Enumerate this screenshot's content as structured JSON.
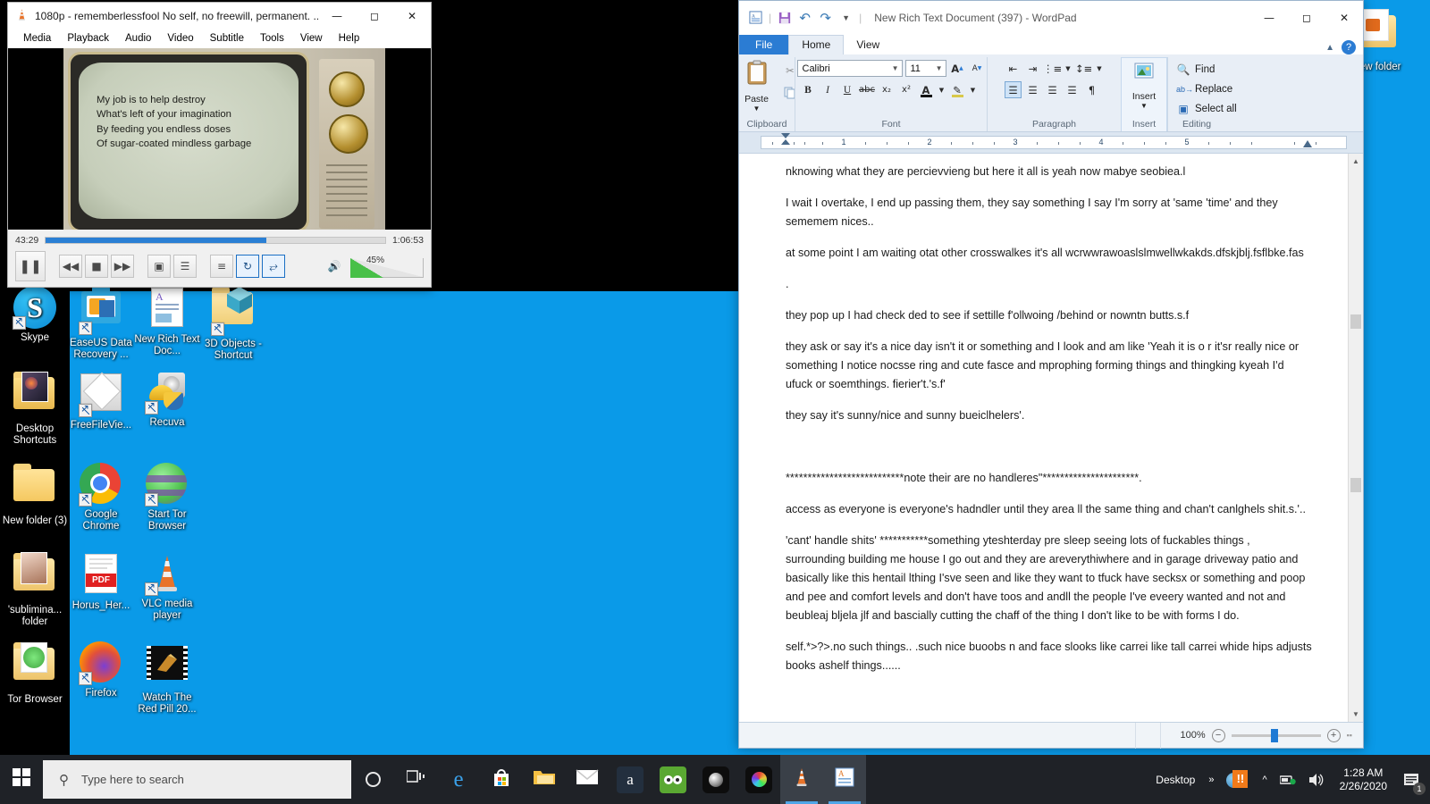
{
  "desktop": {
    "icons": [
      {
        "label": "Skype",
        "name": "desktop-icon-skype",
        "kind": "skype"
      },
      {
        "label": "EaseUS Data Recovery ...",
        "name": "desktop-icon-easeus",
        "kind": "easeus"
      },
      {
        "label": "New Rich Text Doc...",
        "name": "desktop-icon-new-rich-text-doc",
        "kind": "rtf"
      },
      {
        "label": "3D Objects - Shortcut",
        "name": "desktop-icon-3d-objects",
        "kind": "3dobjects"
      },
      {
        "label": "Desktop Shortcuts",
        "name": "desktop-icon-desktop-shortcuts",
        "kind": "folderpic"
      },
      {
        "label": "FreeFileVie...",
        "name": "desktop-icon-freefileviewer",
        "kind": "freefile"
      },
      {
        "label": "Recuva",
        "name": "desktop-icon-recuva",
        "kind": "recuva"
      },
      {
        "label": "New folder (3)",
        "name": "desktop-icon-new-folder-3",
        "kind": "folder"
      },
      {
        "label": "Google Chrome",
        "name": "desktop-icon-google-chrome",
        "kind": "chrome"
      },
      {
        "label": "Start Tor Browser",
        "name": "desktop-icon-start-tor-browser",
        "kind": "tor"
      },
      {
        "label": "'sublimina... folder",
        "name": "desktop-icon-subliminal-folder",
        "kind": "folderpic2"
      },
      {
        "label": "Horus_Her...",
        "name": "desktop-icon-horus-pdf",
        "kind": "pdf"
      },
      {
        "label": "VLC media player",
        "name": "desktop-icon-vlc-media-player",
        "kind": "vlc"
      },
      {
        "label": "Tor Browser",
        "name": "desktop-icon-tor-browser",
        "kind": "folderpic3"
      },
      {
        "label": "Firefox",
        "name": "desktop-icon-firefox",
        "kind": "firefox"
      },
      {
        "label": "Watch The Red Pill 20...",
        "name": "desktop-icon-watch-the-red-pill",
        "kind": "video"
      },
      {
        "label": "New folder",
        "name": "desktop-icon-new-folder-right",
        "kind": "folderpic4"
      }
    ]
  },
  "vlc": {
    "title": "1080p - rememberlessfool No self, no freewill, permanent. ...",
    "menu": [
      "Media",
      "Playback",
      "Audio",
      "Video",
      "Subtitle",
      "Tools",
      "View",
      "Help"
    ],
    "elapsed": "43:29",
    "total": "1:06:53",
    "progress_percent": 65,
    "volume_label": "45%",
    "volume_percent": 45,
    "buttons": {
      "play_pause": "pause-icon",
      "previous": "previous-track-icon",
      "stop": "stop-icon",
      "next": "next-track-icon",
      "fullscreen": "fullscreen-icon",
      "effects": "equalizer-icon",
      "playlist": "playlist-icon",
      "loop": "loop-icon",
      "shuffle": "shuffle-icon",
      "mute": "speaker-icon"
    },
    "video_caption": [
      "My job is to help destroy",
      "What's left of your imagination",
      "By feeding you endless doses",
      "Of sugar-coated mindless garbage"
    ]
  },
  "wordpad": {
    "title": "New Rich Text Document (397) - WordPad",
    "quick_access": [
      "wordpad-icon",
      "save-icon",
      "undo-icon",
      "redo-icon",
      "customize-qat-icon"
    ],
    "tabs": [
      {
        "label": "File",
        "name": "tab-file"
      },
      {
        "label": "Home",
        "name": "tab-home"
      },
      {
        "label": "View",
        "name": "tab-view"
      }
    ],
    "ribbon": {
      "clipboard": {
        "label": "Clipboard",
        "paste": "Paste",
        "cut": "cut-icon",
        "copy": "copy-icon"
      },
      "font": {
        "label": "Font",
        "family": "Calibri",
        "size": "11",
        "grow": "grow-font-icon",
        "shrink": "shrink-font-icon",
        "bold": "B",
        "italic": "I",
        "underline": "U",
        "strikethrough": "abc",
        "subscript": "x₂",
        "superscript": "x²",
        "text_color": "A",
        "highlight": "highlight-icon"
      },
      "paragraph": {
        "label": "Paragraph",
        "decrease_indent": "decrease-indent-icon",
        "increase_indent": "increase-indent-icon",
        "bullets": "bullets-icon",
        "line_spacing": "line-spacing-icon",
        "align_left": "align-left-icon",
        "align_center": "align-center-icon",
        "align_right": "align-right-icon",
        "justify": "justify-icon",
        "paragraph_settings": "paragraph-settings-icon"
      },
      "insert": {
        "label": "Insert",
        "button": "Insert"
      },
      "editing": {
        "label": "Editing",
        "find": "Find",
        "replace": "Replace",
        "select_all": "Select all"
      }
    },
    "ruler_numbers": [
      "1",
      "2",
      "3",
      "4",
      "5"
    ],
    "document": [
      "nknowing what they are percievvieng but here it all is yeah now mabye seobiea.l",
      "I wait I overtake, I end up passing them, they say something I say I'm sorry at 'same 'time' and they sememem nices..",
      "at some point I am waiting otat other crosswalkes it's all wcrwwrawoaslslmwellwkakds.dfskjblj.fsflbke.fas",
      ".",
      " they pop up I had check ded to see if settille f'ollwoing /behind or nowntn butts.s.f",
      "they ask  or say it's a nice day isn't it  or something and I look and am like 'Yeah it is o r it'sr really nice or something I notice nocsse ring and cute fasce and mprophing forming things and thingking kyeah I'd ufuck  or soemthings.  fierier't.'s.f'",
      "they say it's sunny/nice and sunny bueiclhelers'.",
      "",
      "***************************note their are no handleres\"**********************.",
      "access as everyone is everyone's hadndler until they area ll the same thing and chan't canlghels shit.s.'..",
      "'cant' handle shits' ***********something yteshterday pre sleep seeing lots of fuckables things ,  surrounding building me house I go out and they are areverythiwhere and in garage driveway patio and basically like this hentail lthing I'sve seen and like they want to tfuck have secksx or something and poop and pee and comfort levels and don't have toos and andll the people I've eveery wanted and not and beubleaj bljela jlf and bascially cutting the chaff of the thing I don't like to be with forms I do.",
      "self.*>?>.no  such things.. .such nice buoobs n and face slooks like carrei like tall carrei whide hips adjusts books ashelf things......"
    ],
    "status": {
      "zoom": "100%",
      "zoom_out": "zoom-out-icon",
      "zoom_in": "zoom-in-icon",
      "zoom_value": 50
    }
  },
  "taskbar": {
    "start": "windows-start-icon",
    "search_placeholder": "Type here to search",
    "search_icon": "search-icon",
    "cortana": "cortana-icon",
    "task_view": "task-view-icon",
    "pinned": [
      {
        "name": "taskbar-edge",
        "kind": "edge"
      },
      {
        "name": "taskbar-microsoft-store",
        "kind": "store"
      },
      {
        "name": "taskbar-file-explorer",
        "kind": "explorer"
      },
      {
        "name": "taskbar-mail",
        "kind": "mail"
      },
      {
        "name": "taskbar-amazon",
        "kind": "amazon"
      },
      {
        "name": "taskbar-tripadvisor",
        "kind": "tripadvisor"
      },
      {
        "name": "taskbar-camera-app",
        "kind": "cam1"
      },
      {
        "name": "taskbar-color-app",
        "kind": "cam2"
      },
      {
        "name": "taskbar-vlc",
        "kind": "vlc"
      },
      {
        "name": "taskbar-wordpad",
        "kind": "wordpad"
      }
    ],
    "tray": {
      "show_desktop_label": "Desktop",
      "overflow": "show-hidden-icons-chevron",
      "chevron": "˄",
      "network": "network-icon",
      "volume": "volume-icon",
      "time": "1:28 AM",
      "date": "2/26/2020",
      "notifications": "notifications-icon",
      "notification_count": "1"
    }
  }
}
